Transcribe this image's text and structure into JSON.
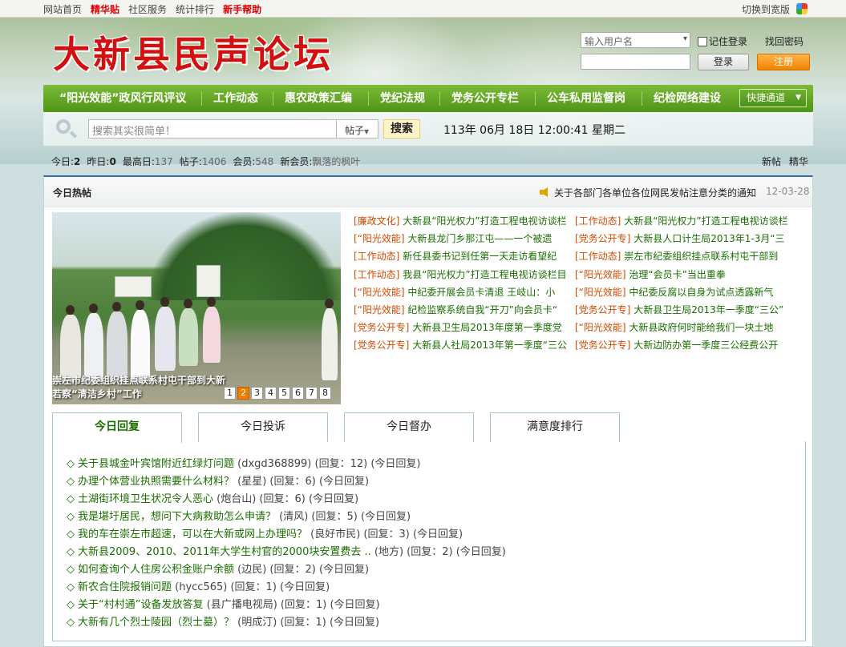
{
  "topbar": {
    "links": [
      {
        "label": "网站首页",
        "highlight": false
      },
      {
        "label": "精华贴",
        "highlight": true
      },
      {
        "label": "社区服务",
        "highlight": false
      },
      {
        "label": "统计排行",
        "highlight": false
      },
      {
        "label": "新手帮助",
        "highlight": true
      }
    ],
    "wide_switch": "切换到宽版"
  },
  "site": {
    "logo": "大新县民声论坛"
  },
  "login": {
    "username_placeholder": "输入用户名",
    "remember_label": "记住登录",
    "forgot_label": "找回密码",
    "login_button": "登录",
    "register_button": "注册"
  },
  "nav": {
    "items": [
      "“阳光效能”政风行风评议",
      "工作动态",
      "惠农政策汇编",
      "党纪法规",
      "党务公开专栏",
      "公车私用监督岗",
      "纪检网络建设"
    ],
    "quick_label": "快捷通道"
  },
  "search": {
    "placeholder": "搜索其实很简单！",
    "type_label": "帖子",
    "button": "搜索",
    "clock": "113年 06月 18日 12:00:41 星期二"
  },
  "stats": {
    "today_label": "今日:",
    "today_value": "2",
    "yesterday_label": "昨日:",
    "yesterday_value": "0",
    "max_label": "最高日:",
    "max_value": "137",
    "posts_label": "帖子:",
    "posts_value": "1406",
    "members_label": "会员:",
    "members_value": "548",
    "newmember_label": "新会员:",
    "newmember_value": "飘落的枫叶",
    "new_posts": "新帖",
    "digest": "精华"
  },
  "hot": {
    "title": "今日热帖",
    "notice": "关于各部门各单位各位网民发帖注意分类的通知",
    "notice_date": "12-03-28",
    "photo_caption": "崇左市纪委组织挂点联系村屯干部到大新若察“清洁乡村”工作",
    "pager": [
      "1",
      "2",
      "3",
      "4",
      "5",
      "6",
      "7",
      "8"
    ],
    "pager_active": 2,
    "left_column": [
      {
        "cat": "[廉政文化]",
        "title": "大新县“阳光权力”打造工程电视访谈栏"
      },
      {
        "cat": "[“阳光效能]",
        "title": "大新县龙门乡那江屯——一个被遗"
      },
      {
        "cat": "[工作动态]",
        "title": "新任县委书记到任第一天走访看望纪"
      },
      {
        "cat": "[工作动态]",
        "title": "我县“阳光权力”打造工程电视访谈栏目"
      },
      {
        "cat": "[“阳光效能]",
        "title": "中纪委开展会员卡清退 王岐山：小"
      },
      {
        "cat": "[“阳光效能]",
        "title": "纪检监察系统自我“开刀”向会员卡“"
      },
      {
        "cat": "[党务公开专]",
        "title": "大新县卫生局2013年度第一季度党"
      },
      {
        "cat": "[党务公开专]",
        "title": "大新县人社局2013年第一季度“三公"
      }
    ],
    "right_column": [
      {
        "cat": "[工作动态]",
        "title": "大新县“阳光权力”打造工程电视访谈栏"
      },
      {
        "cat": "[党务公开专]",
        "title": "大新县人口计生局2013年1-3月“三"
      },
      {
        "cat": "[工作动态]",
        "title": "崇左市纪委组织挂点联系村屯干部到"
      },
      {
        "cat": "[“阳光效能]",
        "title": "治理“会员卡”当出重拳"
      },
      {
        "cat": "[“阳光效能]",
        "title": "中纪委反腐以自身为试点透露新气"
      },
      {
        "cat": "[党务公开专]",
        "title": "大新县卫生局2013年一季度“三公”"
      },
      {
        "cat": "[“阳光效能]",
        "title": "大新县政府何时能给我们一块土地"
      },
      {
        "cat": "[党务公开专]",
        "title": "大新边防办第一季度三公经费公开"
      }
    ]
  },
  "tabs": [
    "今日回复",
    "今日投诉",
    "今日督办",
    "满意度排行"
  ],
  "replies": [
    {
      "title": "关于县城金叶宾馆附近红绿灯问题",
      "meta": "(dxgd368899) (回复：12) (今日回复)"
    },
    {
      "title": "办理个体营业执照需要什么材料？",
      "meta": "(星星) (回复：6) (今日回复)"
    },
    {
      "title": "土湖街环境卫生状况令人恶心",
      "meta": "(炮台山) (回复：6) (今日回复)"
    },
    {
      "title": "我是堪圩居民，想问下大病救助怎么申请？",
      "meta": "(清风) (回复：5) (今日回复)"
    },
    {
      "title": "我的车在崇左市超速，可以在大新或网上办理吗？",
      "meta": "(良好市民) (回复：3) (今日回复)"
    },
    {
      "title": "大新县2009、2010、2011年大学生村官的2000块安置费去 ..",
      "meta": "(地方) (回复：2) (今日回复)"
    },
    {
      "title": "如何查询个人住房公积金账户余额",
      "meta": "(边民) (回复：2) (今日回复)"
    },
    {
      "title": "新农合住院报销问题",
      "meta": "(hycc565) (回复：1) (今日回复)"
    },
    {
      "title": "关于“村村通”设备发放答复",
      "meta": "(县广播电视局) (回复：1) (今日回复)"
    },
    {
      "title": "大新有几个烈士陵园（烈士墓）？",
      "meta": "(明成汀) (回复：1) (今日回复)"
    }
  ]
}
